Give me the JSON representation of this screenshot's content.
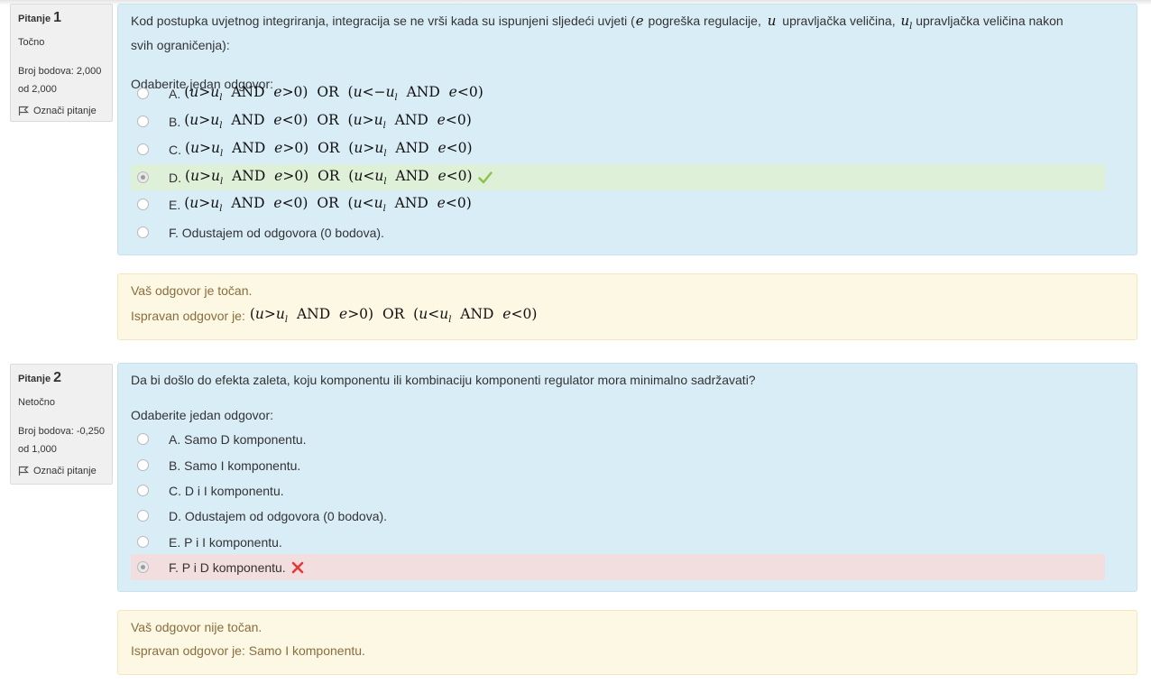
{
  "questions": [
    {
      "label": "Pitanje",
      "number": "1",
      "state": "Točno",
      "grade": "Broj bodova: 2,000 od 2,000",
      "flag": "Označi pitanje",
      "text_parts": [
        "Kod postupka uvjetnog integriranja, integracija se ne vrši kada su ispunjeni sljedeći uvjeti (",
        "e",
        " pogreška regulacije, ",
        "u",
        " upravljačka veličina, ",
        "u",
        "l",
        " upravljačka veličina nakon svih ograničenja):"
      ],
      "prompt": "Odaberite jedan odgovor:",
      "options": [
        {
          "letter": "A.",
          "math": "(u>u_l AND e>0) OR (u<−u_l AND e<0)",
          "selected": false
        },
        {
          "letter": "B.",
          "math": "(u>u_l AND e<0) OR (u>u_l AND e<0)",
          "selected": false
        },
        {
          "letter": "C.",
          "math": "(u>u_l AND e>0) OR (u>u_l AND e<0)",
          "selected": false
        },
        {
          "letter": "D.",
          "math": "(u>u_l AND e>0) OR (u<u_l AND e<0)",
          "selected": true,
          "result": "correct"
        },
        {
          "letter": "E.",
          "math": "(u>u_l AND e<0) OR (u<u_l AND e<0)",
          "selected": false
        },
        {
          "letter": "F.",
          "text": "Odustajem od odgovora (0 bodova).",
          "selected": false
        }
      ],
      "feedback_result": "Vaš odgovor je točan.",
      "feedback_correct_label": "Ispravan odgovor je:",
      "feedback_correct_math": "(u>u_l AND e>0) OR (u<u_l AND e<0)"
    },
    {
      "label": "Pitanje",
      "number": "2",
      "state": "Netočno",
      "grade": "Broj bodova: -0,250 od 1,000",
      "flag": "Označi pitanje",
      "text": "Da bi došlo do efekta zaleta, koju komponentu ili kombinaciju komponenti regulator mora minimalno sadržavati?",
      "prompt": "Odaberite jedan odgovor:",
      "options": [
        {
          "letter": "A.",
          "text": "Samo D komponentu.",
          "selected": false
        },
        {
          "letter": "B.",
          "text": "Samo I komponentu.",
          "selected": false
        },
        {
          "letter": "C.",
          "text": "D i I komponentu.",
          "selected": false
        },
        {
          "letter": "D.",
          "text": "Odustajem od odgovora (0 bodova).",
          "selected": false
        },
        {
          "letter": "E.",
          "text": "P i I komponentu.",
          "selected": false
        },
        {
          "letter": "F.",
          "text": "P i D komponentu.",
          "selected": true,
          "result": "incorrect"
        }
      ],
      "feedback_result": "Vaš odgovor nije točan.",
      "feedback_correct": "Ispravan odgovor je: Samo I komponentu."
    }
  ],
  "colors": {
    "question_bg": "#d9edf7",
    "info_bg": "#f0f0f0",
    "feedback_bg": "#fcf8e3",
    "feedback_text": "#8a6d3b",
    "correct_bg": "#dff0d8",
    "incorrect_bg": "#f2dede",
    "correct_mark": "#8bc34a",
    "incorrect_mark": "#e53935"
  },
  "icons": {
    "flag": "flag-icon",
    "correct": "check-icon",
    "incorrect": "cross-icon"
  }
}
